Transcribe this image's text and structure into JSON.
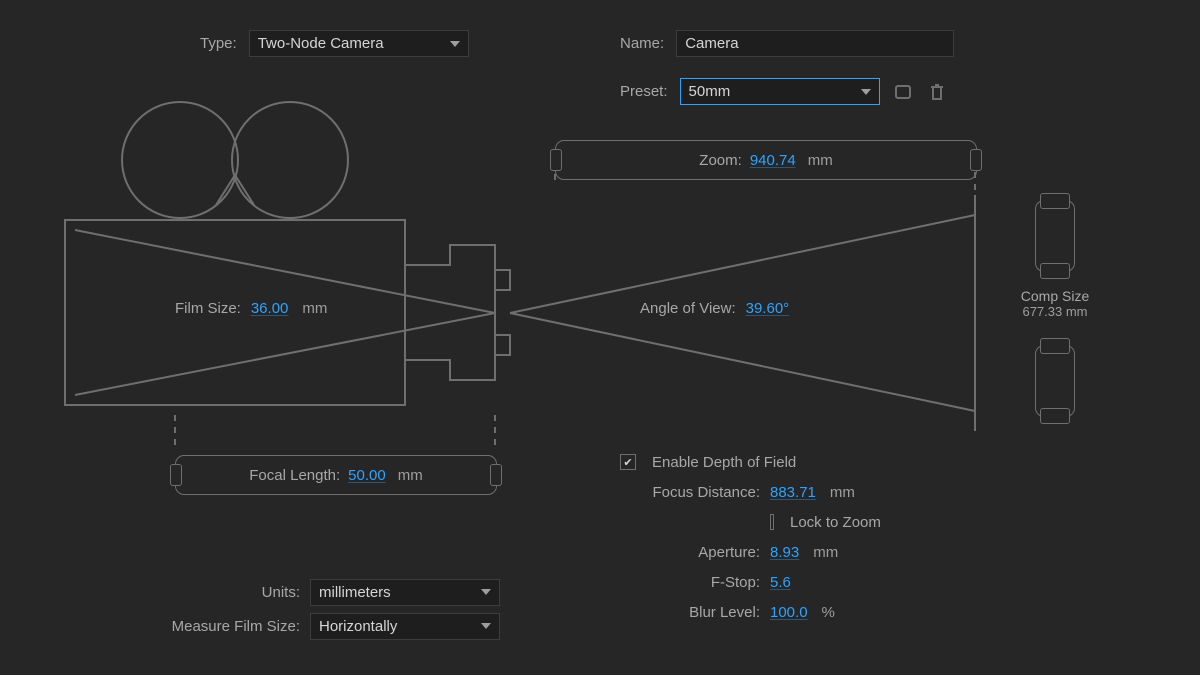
{
  "header": {
    "type_label": "Type:",
    "type_value": "Two-Node Camera",
    "name_label": "Name:",
    "name_value": "Camera",
    "preset_label": "Preset:",
    "preset_value": "50mm"
  },
  "diagram": {
    "film_size": {
      "label": "Film Size:",
      "value": "36.00",
      "unit": "mm"
    },
    "focal_length": {
      "label": "Focal Length:",
      "value": "50.00",
      "unit": "mm"
    },
    "zoom": {
      "label": "Zoom:",
      "value": "940.74",
      "unit": "mm"
    },
    "angle_of_view": {
      "label": "Angle of View:",
      "value": "39.60"
    },
    "comp_size": {
      "label": "Comp Size",
      "value": "677.33 mm"
    }
  },
  "dof": {
    "enable_label": "Enable Depth of Field",
    "enable_checked": true,
    "focus_distance": {
      "label": "Focus Distance:",
      "value": "883.71",
      "unit": "mm"
    },
    "lock_label": "Lock to Zoom",
    "lock_checked": false,
    "aperture": {
      "label": "Aperture:",
      "value": "8.93",
      "unit": "mm"
    },
    "fstop": {
      "label": "F-Stop:",
      "value": "5.6"
    },
    "blur": {
      "label": "Blur Level:",
      "value": "100.0",
      "unit": "%"
    }
  },
  "bottom": {
    "units_label": "Units:",
    "units_value": "millimeters",
    "measure_label": "Measure Film Size:",
    "measure_value": "Horizontally"
  }
}
